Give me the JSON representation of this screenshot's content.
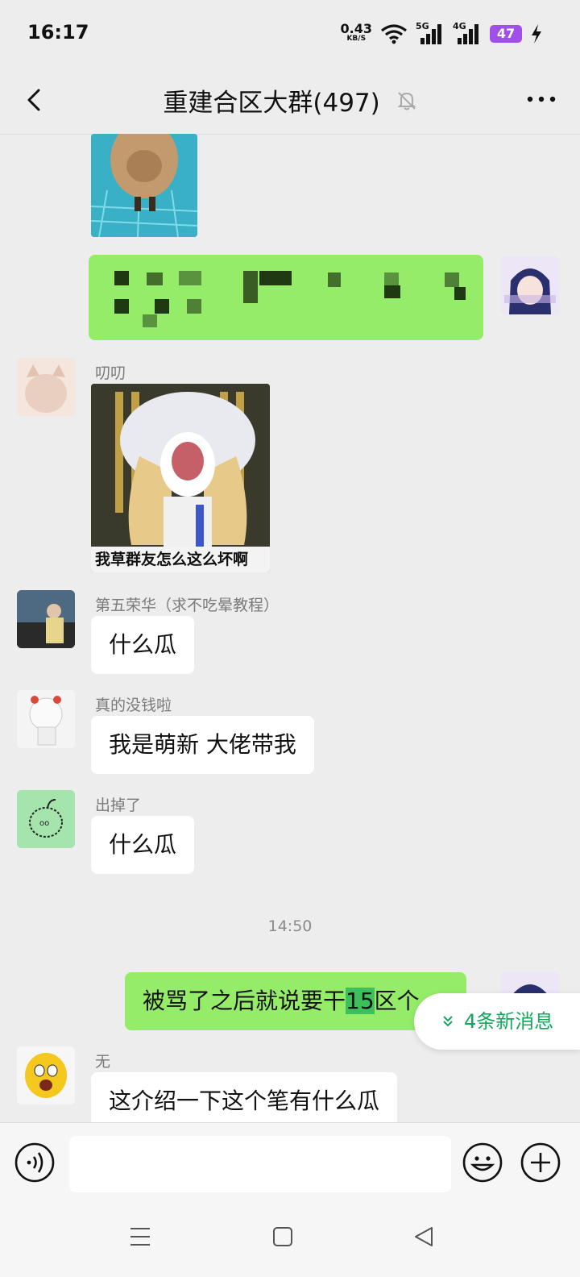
{
  "status_bar": {
    "time": "16:17",
    "net_speed": "0.43",
    "net_speed_unit": "KB/S",
    "signal_1": "5G",
    "signal_2": "4G",
    "battery": "47"
  },
  "header": {
    "title": "重建合区大群(497)",
    "back_icon": "chevron-left-icon",
    "mute_icon": "bell-off-icon",
    "more_icon": "ellipsis-icon"
  },
  "messages": [
    {
      "type": "image",
      "content": "capybara-swimming-photo"
    },
    {
      "type": "pixelated-text",
      "mine": true
    },
    {
      "sender": "叨叨",
      "type": "sticker",
      "caption": "我草群友怎么这么坏啊"
    },
    {
      "sender": "第五荣华（求不吃晕教程）",
      "text": "什么瓜"
    },
    {
      "sender": "真的没钱啦",
      "text": "我是萌新 大佬带我"
    },
    {
      "sender": "出掉了",
      "text": "什么瓜"
    },
    {
      "timestamp": "14:50"
    },
    {
      "mine": true,
      "text_before": "被骂了之后就说要干",
      "text_highlight": "15",
      "text_after": "区",
      "trailing_fragment": "个"
    },
    {
      "sender": "无",
      "text": "这介绍一下这个笔有什么瓜"
    }
  ],
  "new_messages_badge": {
    "label": "4条新消息",
    "icon": "double-chevron-down-icon"
  },
  "input_bar": {
    "voice_icon": "voice-icon",
    "emoji_icon": "emoji-icon",
    "plus_icon": "plus-icon"
  },
  "system_nav": {
    "menu_icon": "menu-icon",
    "home_icon": "home-square-icon",
    "back_icon": "back-triangle-icon"
  },
  "colors": {
    "my_bubble": "#95ec69",
    "background": "#ededed",
    "accent_green": "#11a85a"
  }
}
